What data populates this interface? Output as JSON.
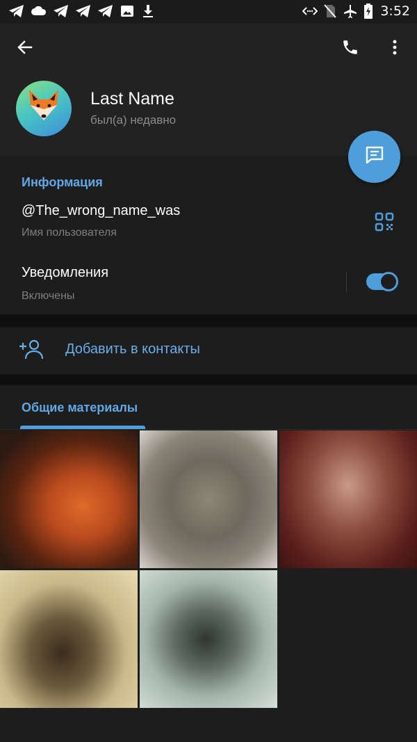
{
  "status_bar": {
    "time": "3:52",
    "left_icons": [
      "telegram-icon",
      "cloud-icon",
      "telegram-icon",
      "telegram-icon",
      "telegram-icon",
      "image-icon",
      "download-icon"
    ],
    "right_icons": [
      "data-saver-icon",
      "no-sim-icon",
      "airplane-icon",
      "battery-charging-icon"
    ]
  },
  "header": {
    "back_icon": "arrow-back-icon",
    "call_icon": "phone-icon",
    "more_icon": "more-vertical-icon"
  },
  "profile": {
    "name": "Last Name",
    "status": "был(а) недавно",
    "avatar_icon": "fox-emoji",
    "avatar_glyph": "🦊"
  },
  "fab": {
    "icon": "message-icon"
  },
  "info": {
    "title": "Информация",
    "username": "@The_wrong_name_was",
    "username_label": "Имя пользователя",
    "qr_icon": "qr-code-icon",
    "notifications_label": "Уведомления",
    "notifications_state": "Включены",
    "notifications_enabled": true
  },
  "add_contact": {
    "label": "Добавить в контакты",
    "icon": "add-person-icon"
  },
  "shared": {
    "tab_label": "Общие материалы",
    "thumbnail_count": 5
  },
  "colors": {
    "accent": "#4e9edc",
    "accent_text": "#62a8e6",
    "background": "#1d1d1d",
    "header_bg": "#222222"
  }
}
